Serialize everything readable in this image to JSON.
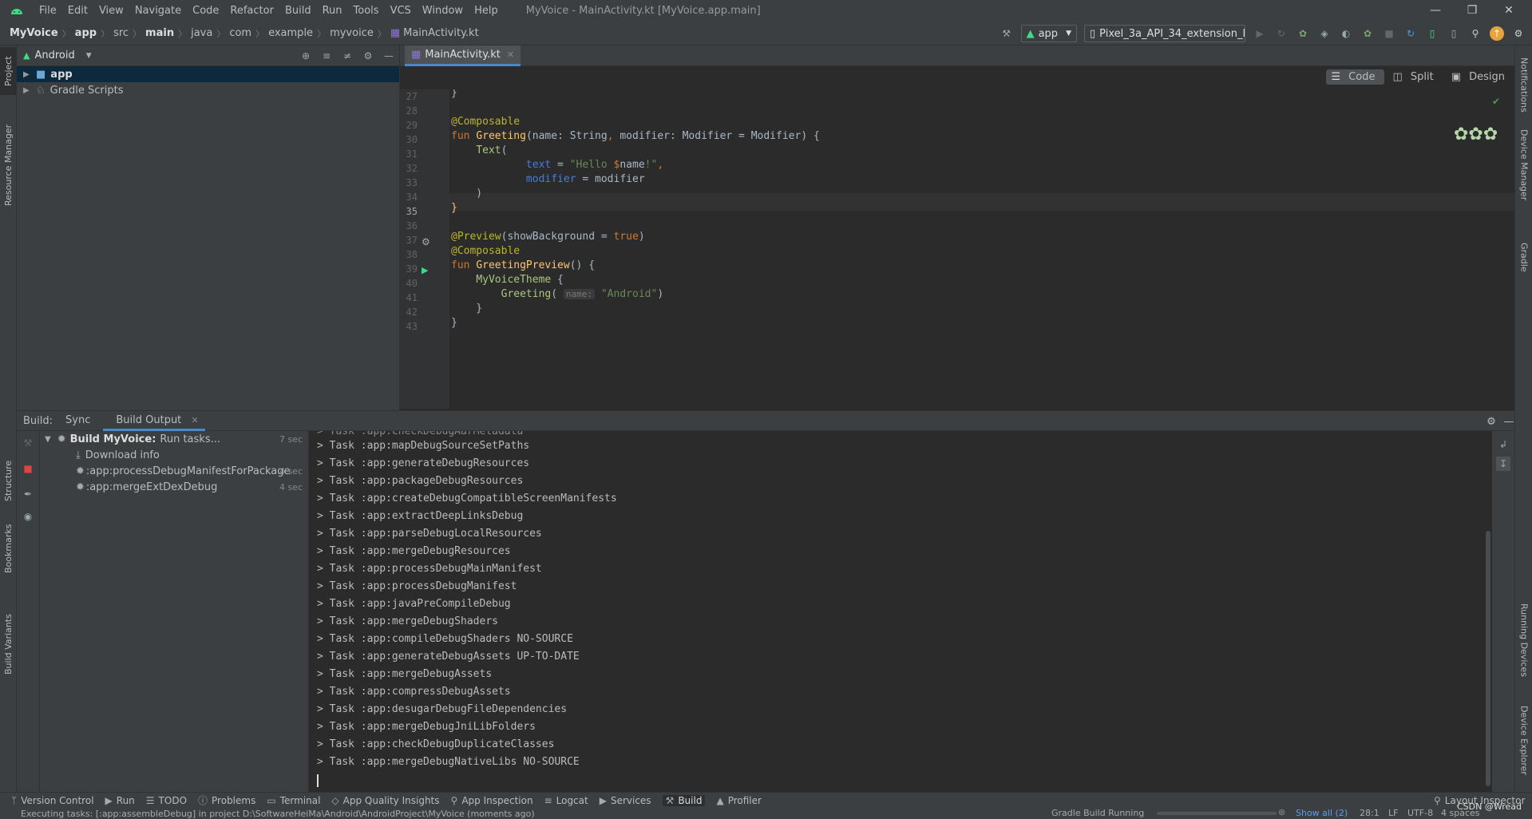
{
  "window": {
    "title": "MyVoice - MainActivity.kt [MyVoice.app.main]",
    "menu": [
      "File",
      "Edit",
      "View",
      "Navigate",
      "Code",
      "Refactor",
      "Build",
      "Run",
      "Tools",
      "VCS",
      "Window",
      "Help"
    ]
  },
  "breadcrumb": [
    "MyVoice",
    "app",
    "src",
    "main",
    "java",
    "com",
    "example",
    "myvoice",
    "MainActivity.kt"
  ],
  "toolbar": {
    "run_config": "app",
    "device": "Pixel_3a_API_34_extension_level_7_x..."
  },
  "project": {
    "view_selector": "Android",
    "items": [
      {
        "label": "app",
        "selected": true
      },
      {
        "label": "Gradle Scripts",
        "selected": false
      }
    ]
  },
  "editor": {
    "tab": "MainActivity.kt",
    "modes": [
      "Code",
      "Split",
      "Design"
    ],
    "active_mode": "Code",
    "line_numbers": [
      "27",
      "28",
      "29",
      "30",
      "31",
      "32",
      "33",
      "34",
      "35",
      "36",
      "37",
      "38",
      "39",
      "40",
      "41",
      "42",
      "43"
    ]
  },
  "left_tools": [
    "Project",
    "Resource Manager",
    "Structure",
    "Bookmarks",
    "Build Variants"
  ],
  "right_tools": [
    "Notifications",
    "Device Manager",
    "Gradle",
    "Running Devices",
    "Device Explorer"
  ],
  "build_panel": {
    "label": "Build:",
    "tabs": [
      "Sync",
      "Build Output"
    ],
    "active_tab": "Build Output",
    "tree": [
      {
        "label": "Build MyVoice:",
        "suffix": "Run tasks...",
        "time": "7 sec"
      },
      {
        "label": "Download info",
        "time": ""
      },
      {
        "label": ":app:processDebugManifestForPackage",
        "time": "4 sec"
      },
      {
        "label": ":app:mergeExtDexDebug",
        "time": "4 sec"
      }
    ],
    "output": [
      "> Task :app:mapDebugSourceSetPaths",
      "> Task :app:generateDebugResources",
      "> Task :app:packageDebugResources",
      "> Task :app:createDebugCompatibleScreenManifests",
      "> Task :app:extractDeepLinksDebug",
      "> Task :app:parseDebugLocalResources",
      "> Task :app:mergeDebugResources",
      "> Task :app:processDebugMainManifest",
      "> Task :app:processDebugManifest",
      "> Task :app:javaPreCompileDebug",
      "> Task :app:mergeDebugShaders",
      "> Task :app:compileDebugShaders NO-SOURCE",
      "> Task :app:generateDebugAssets UP-TO-DATE",
      "> Task :app:mergeDebugAssets",
      "> Task :app:compressDebugAssets",
      "> Task :app:desugarDebugFileDependencies",
      "> Task :app:mergeDebugJniLibFolders",
      "> Task :app:checkDebugDuplicateClasses",
      "> Task :app:mergeDebugNativeLibs NO-SOURCE"
    ]
  },
  "bottom_tools": [
    "Version Control",
    "Run",
    "TODO",
    "Problems",
    "Terminal",
    "App Quality Insights",
    "App Inspection",
    "Logcat",
    "Services",
    "Build",
    "Profiler"
  ],
  "bottom_right_tool": "Layout Inspector",
  "status": {
    "message": "Executing tasks: [:app:assembleDebug] in project D:\\SoftwareHeiMa\\Android\\AndroidProject\\MyVoice (moments ago)",
    "progress_label": "Gradle Build Running",
    "show_all": "Show all (2)",
    "position": "28:1",
    "line_sep": "LF",
    "encoding": "UTF-8",
    "indent": "4 spaces",
    "watermark": "CSDN @Wread"
  }
}
